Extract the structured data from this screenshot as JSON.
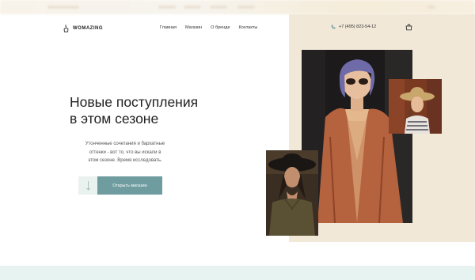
{
  "header": {
    "logo_text": "WOMAZING",
    "nav": [
      "Главная",
      "Магазин",
      "О бренде",
      "Контакты"
    ],
    "phone": "+7 (495) 823-54-12"
  },
  "hero": {
    "title_line1": "Новые поступления",
    "title_line2": "в этом сезоне",
    "description_lines": [
      "Утонченные сочетания и бархатные",
      "оттенки - вот то, что вы искали в",
      "этом сезоне. Время исследовать."
    ],
    "cta_label": "Открыть магазин"
  },
  "icons": {
    "logo": "hanger-icon",
    "phone": "phone-icon",
    "cart": "shopping-bag-icon",
    "scroll": "arrow-down-icon"
  },
  "colors": {
    "accent": "#6e9c9f",
    "arrow_button_bg": "#eaf2f0",
    "beige_panel": "#f1e8d8",
    "bottom_strip": "#e6f3f0"
  }
}
